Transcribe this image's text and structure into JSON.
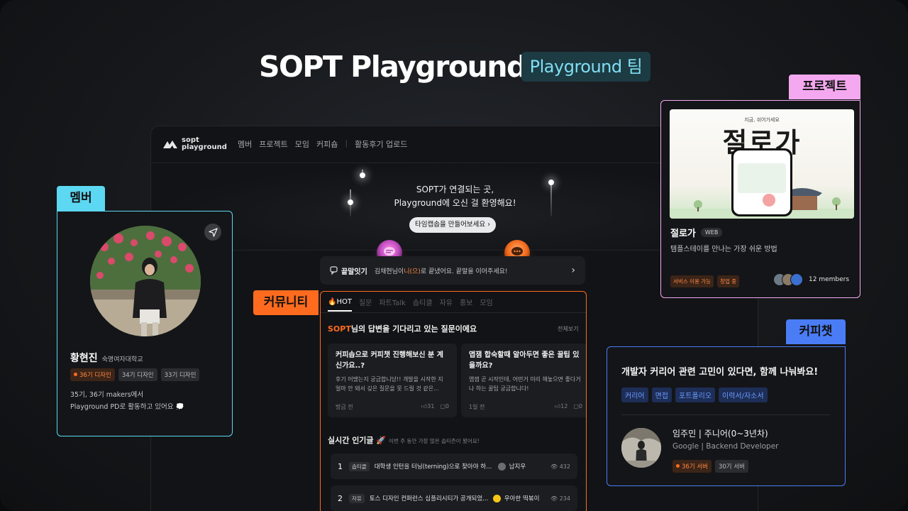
{
  "hero": {
    "title": "SOPT Playground",
    "team_badge": "Playground 팀"
  },
  "panel": {
    "logo_text": "sopt\nplayground",
    "nav": [
      "멤버",
      "프로젝트",
      "모임",
      "커피숍",
      "활동후기 업로드"
    ],
    "banner_text": "SOPT가 연결되는 곳,\nPlayground에 오신 걸 환영해요!",
    "banner_button": "타임캡솝을 만들어보세요",
    "relay": {
      "title": "끝말잇기",
      "prefix": "김채현님이 ",
      "word": "니(으)",
      "suffix": "로 끝냈어요. 끝말을 이어주세요!"
    }
  },
  "community": {
    "label": "커뮤니티",
    "tabs": [
      "HOT",
      "질문",
      "파트Talk",
      "솝티클",
      "자유",
      "홍보",
      "모임"
    ],
    "question_head_brand": "SOPT",
    "question_head_rest": "님의 답변을 기다리고 있는 질문이에요",
    "see_all": "전체보기",
    "questions": [
      {
        "title": "커피솝으로 커피챗 진행해보신 분 계신가요..?",
        "body": "후기 어땠는지 궁금합니당!! 개발을 시작한 지 얼마 안 돼서 깊은 질문을 못 드릴 것 같은...",
        "time": "방금 전",
        "likes": "31",
        "comments": "0"
      },
      {
        "title": "앱잼 합숙할때 알아두면 좋은 꿀팁 있을까요?",
        "body": "앱잼 곧 시작인데, 어떤거 미리 해놓으면 좋다거나 하는 꿀팁 궁금합니다!",
        "time": "1일 전",
        "likes": "12",
        "comments": "0"
      }
    ],
    "popular_head": "실시간 인기글 🚀",
    "popular_sub": "이번 주 동안 가장 많은 솝티즌이 봤어요!",
    "popular": [
      {
        "rank": "1",
        "tag": "솝티클",
        "title": "대학생 인턴을 터닝(terning)으로 찾아야 하...",
        "author": "남지우",
        "views": "432"
      },
      {
        "rank": "2",
        "tag": "자유",
        "title": "토스 디자인 컨퍼런스 심플리시티가 공개되었...",
        "author": "우아한 떡볶이",
        "views": "234"
      }
    ]
  },
  "member": {
    "label": "멤버",
    "name": "황현진",
    "school": "숙명여자대학교",
    "badges": [
      "36기 디자인",
      "34기 디자인",
      "33기 디자인"
    ],
    "desc": "35기, 36기 makers에서\nPlayground PD로 활동하고 있어요 💭"
  },
  "project": {
    "label": "프로젝트",
    "thumb_small": "지금, 쉬어가세요",
    "thumb_big": "절로가",
    "name": "절로가",
    "type": "WEB",
    "desc": "템플스테이를 만나는 가장 쉬운 방법",
    "badges": [
      "서비스 이용 가능",
      "창업 중"
    ],
    "members": "12 members"
  },
  "coffee": {
    "label": "커피챗",
    "title": "개발자 커리어 관련 고민이 있다면, 함께 나눠봐요!",
    "tags": [
      "커리어",
      "면접",
      "포트폴리오",
      "이력서/자소서"
    ],
    "name": "임주민 | 주니어(0~3년차)",
    "job": "Google |  Backend Developer",
    "badges": [
      "36기 서버",
      "30기 서버"
    ]
  },
  "colors": {
    "accent_orange": "#ff6b1e",
    "member_cyan": "#5cd8f2",
    "project_pink": "#f4a8f0",
    "coffee_blue": "#4a7cf5"
  }
}
